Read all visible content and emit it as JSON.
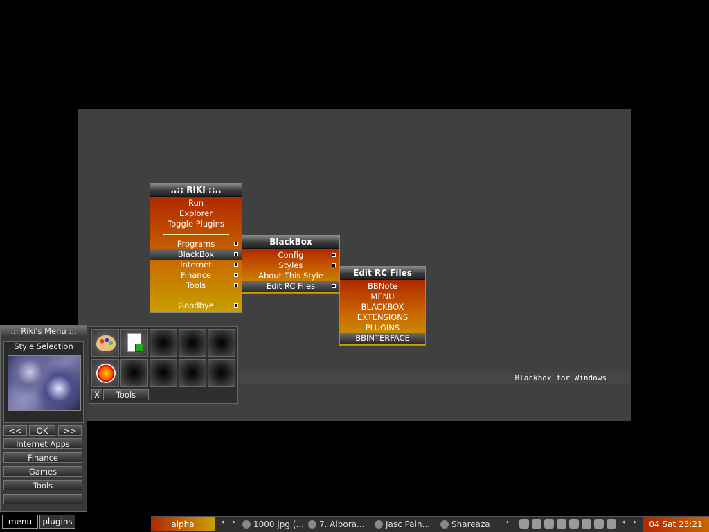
{
  "desktop": {
    "label": "Blackbox for Windows"
  },
  "menus": {
    "riki": {
      "title": "..:: RIKI ::..",
      "items": [
        {
          "label": "Run",
          "sub": false
        },
        {
          "label": "Explorer",
          "sub": false
        },
        {
          "label": "Toggle Plugins",
          "sub": false
        },
        {
          "label": "",
          "separator": true
        },
        {
          "label": "Programs",
          "sub": true
        },
        {
          "label": "BlackBox",
          "sub": true,
          "selected": true
        },
        {
          "label": "Internet",
          "sub": true
        },
        {
          "label": "Finance",
          "sub": true
        },
        {
          "label": "Tools",
          "sub": true
        },
        {
          "label": "",
          "separator": true
        },
        {
          "label": "Goodbye",
          "sub": true
        }
      ]
    },
    "blackbox": {
      "title": "BlackBox",
      "items": [
        {
          "label": "Config",
          "sub": true
        },
        {
          "label": "Styles",
          "sub": true
        },
        {
          "label": "About This Style",
          "sub": false
        },
        {
          "label": "Edit RC Files",
          "sub": true,
          "selected": true
        }
      ]
    },
    "edit_rc": {
      "title": "Edit RC Files",
      "items": [
        {
          "label": "BBNote",
          "sub": false
        },
        {
          "label": "MENU",
          "sub": false
        },
        {
          "label": "BLACKBOX",
          "sub": false
        },
        {
          "label": "EXTENSIONS",
          "sub": false
        },
        {
          "label": "PLUGINS",
          "sub": false
        },
        {
          "label": "BBINTERFACE",
          "sub": false,
          "selected": true
        }
      ]
    }
  },
  "riki_panel": {
    "title": ".:: Riki's Menu ::.",
    "style_selection": "Style Selection",
    "prev": "<<",
    "ok": "OK",
    "next": ">>",
    "buttons": [
      "Internet Apps",
      "Finance",
      "Games",
      "Tools",
      ""
    ]
  },
  "tools_panel": {
    "close": "X",
    "label": "Tools",
    "icons": [
      "paint-palette-icon",
      "document-icon",
      "",
      "",
      "",
      "fire-icon",
      "",
      "",
      "",
      ""
    ]
  },
  "taskbar": {
    "menu": "menu",
    "plugins": "plugins",
    "workspace": "alpha",
    "tasks": [
      "1000.jpg (...",
      "7. Albora...",
      "Jasc Pain...",
      "Shareaza"
    ],
    "clock": "04 Sat 23:21"
  },
  "colors": {
    "menu_gradient_top": "#b02800",
    "menu_gradient_bottom": "#c8a000",
    "desktop": "#404040"
  }
}
